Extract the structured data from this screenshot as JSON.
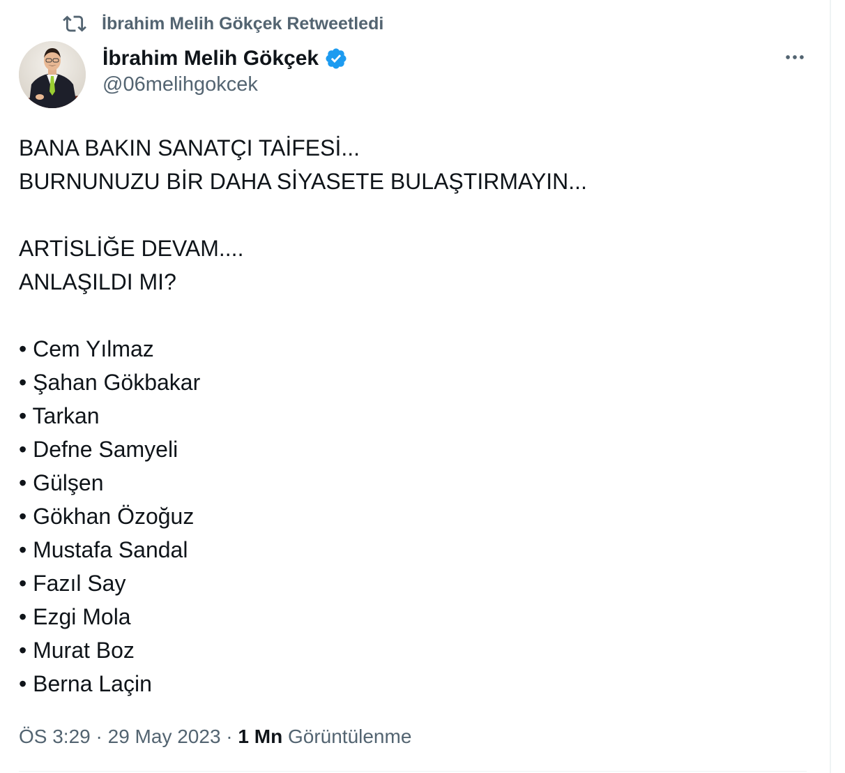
{
  "retweet": {
    "label": "İbrahim Melih Gökçek Retweetledi"
  },
  "author": {
    "display_name": "İbrahim Melih Gökçek",
    "handle": "@06melihgokcek",
    "verified": true
  },
  "tweet": {
    "lines": [
      "BANA BAKIN SANATÇI TAİFESİ...",
      "BURNUNUZU BİR DAHA SİYASETE BULAŞTIRMAYIN...",
      "",
      "ARTİSLİĞE DEVAM....",
      "ANLAŞILDI MI?",
      "",
      "• Cem Yılmaz",
      "• Şahan Gökbakar",
      "• Tarkan",
      "• Defne Samyeli",
      "• Gülşen",
      "• Gökhan Özoğuz",
      "• Mustafa Sandal",
      "• Fazıl Say",
      "• Ezgi Mola",
      "• Murat Boz",
      "• Berna Laçin"
    ]
  },
  "meta": {
    "time": "ÖS 3:29",
    "separator": " · ",
    "date": "29 May 2023",
    "views_count": "1 Mn",
    "views_label": "Görüntülenme"
  },
  "colors": {
    "text_primary": "#0f1419",
    "text_secondary": "#536471",
    "verified_blue": "#1d9bf0",
    "divider": "#eff3f4"
  },
  "icons": {
    "retweet": "retweet-icon",
    "verified": "verified-badge-icon",
    "more": "more-options-icon"
  }
}
